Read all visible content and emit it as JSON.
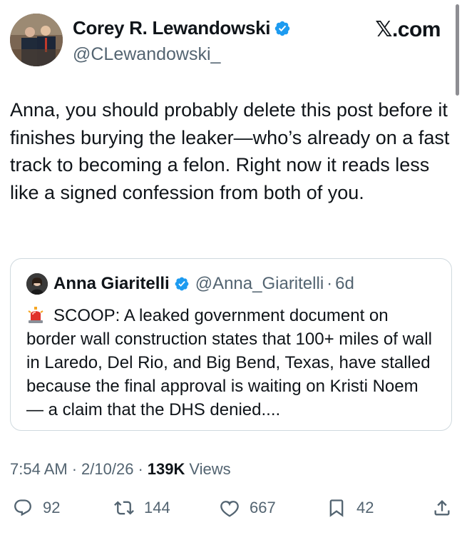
{
  "author": {
    "name": "Corey R. Lewandowski",
    "handle": "@CLewandowski_",
    "verified": true
  },
  "brand": "𝕏.com",
  "tweet": {
    "text": "Anna, you should probably delete this post before it finishes burying the leaker—who’s already on a fast track to becoming a felon. Right now it reads less like a signed confession from both of you."
  },
  "quoted": {
    "name": "Anna Giaritelli",
    "handle": "@Anna_Giaritelli",
    "dot": "·",
    "time": "6d",
    "verified": true,
    "emoji": "siren-icon",
    "text": "SCOOP: A leaked government document on border wall construction states that 100+ miles of wall in Laredo, Del Rio, and Big Bend, Texas, have stalled because the final approval is waiting on Kristi Noem — a claim that the DHS denied...."
  },
  "meta": {
    "time": "7:54 AM",
    "date": "2/10/26",
    "sep": "·",
    "views_count": "139K",
    "views_label": "Views"
  },
  "actions": {
    "replies": "92",
    "reposts": "144",
    "likes": "667",
    "bookmarks": "42"
  },
  "colors": {
    "verified_blue": "#1d9bf0",
    "secondary_text": "#536471",
    "border": "#cfd9de"
  }
}
